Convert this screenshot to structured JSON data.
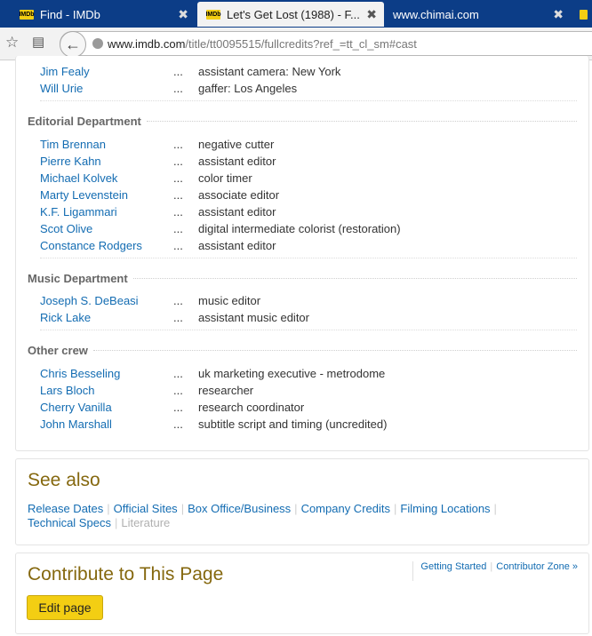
{
  "browser": {
    "tabs": [
      {
        "title": "Find - IMDb",
        "favicon": "IMDb"
      },
      {
        "title": "Let's Get Lost (1988) - F...",
        "favicon": "IMDb"
      },
      {
        "title": "www.chimai.com",
        "favicon": ""
      },
      {
        "title": "",
        "favicon": ""
      }
    ],
    "close_glyph": "✖",
    "url_host": "www.imdb.com",
    "url_path": "/title/tt0095515/fullcredits?ref_=tt_cl_sm#cast"
  },
  "top_rows": [
    {
      "name": "Jim Fealy",
      "credit": "assistant camera: New York"
    },
    {
      "name": "Will Urie",
      "credit": "gaffer: Los Angeles"
    }
  ],
  "departments": [
    {
      "title": "Editorial Department",
      "rows": [
        {
          "name": "Tim Brennan",
          "credit": "negative cutter"
        },
        {
          "name": "Pierre Kahn",
          "credit": "assistant editor"
        },
        {
          "name": "Michael Kolvek",
          "credit": "color timer"
        },
        {
          "name": "Marty Levenstein",
          "credit": "associate editor"
        },
        {
          "name": "K.F. Ligammari",
          "credit": "assistant editor"
        },
        {
          "name": "Scot Olive",
          "credit": "digital intermediate colorist (restoration)"
        },
        {
          "name": "Constance Rodgers",
          "credit": "assistant editor"
        }
      ]
    },
    {
      "title": "Music Department",
      "rows": [
        {
          "name": "Joseph S. DeBeasi",
          "credit": "music editor"
        },
        {
          "name": "Rick Lake",
          "credit": "assistant music editor"
        }
      ]
    },
    {
      "title": "Other crew",
      "rows": [
        {
          "name": "Chris Besseling",
          "credit": "uk marketing executive - metrodome"
        },
        {
          "name": "Lars Bloch",
          "credit": "researcher"
        },
        {
          "name": "Cherry Vanilla",
          "credit": "research coordinator"
        },
        {
          "name": "John Marshall",
          "credit": "subtitle script and timing (uncredited)"
        }
      ]
    }
  ],
  "dots": "...",
  "see_also": {
    "title": "See also",
    "links": [
      "Release Dates",
      "Official Sites",
      "Box Office/Business",
      "Company Credits",
      "Filming Locations",
      "Technical Specs"
    ],
    "disabled_link": "Literature"
  },
  "contribute": {
    "title": "Contribute to This Page",
    "getting_started": "Getting Started",
    "contributor_zone": "Contributor Zone »",
    "edit_button": "Edit page"
  },
  "colors": {
    "link": "#136cb2",
    "heading_gold": "#85680f",
    "imdb_yellow": "#f3ce13",
    "tabbar": "#0c3d87"
  }
}
